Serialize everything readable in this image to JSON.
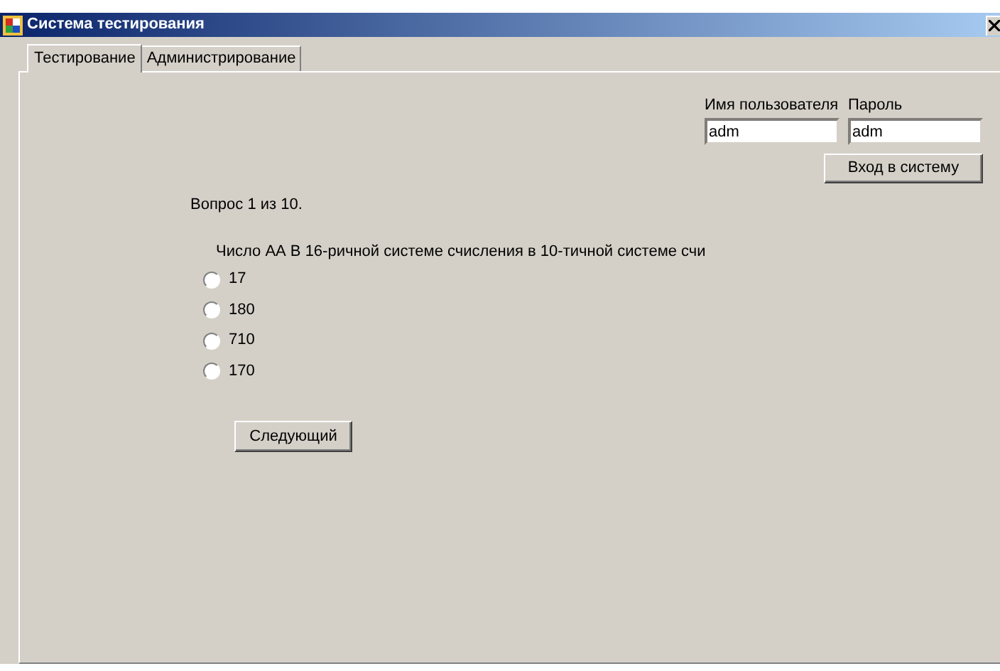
{
  "window": {
    "title": "Система тестирования"
  },
  "tabs": [
    {
      "label": "Тестирование",
      "selected": true
    },
    {
      "label": "Администрирование",
      "selected": false
    }
  ],
  "login": {
    "username_label": "Имя пользователя",
    "username_value": "adm",
    "password_label": "Пароль",
    "password_value": "adm",
    "button": "Вход в систему"
  },
  "question": {
    "counter": "Вопрос 1 из 10.",
    "text": "Число АА В 16-ричной системе счисления в 10-тичной системе счи",
    "options": [
      {
        "label": "17",
        "selected": false
      },
      {
        "label": "180",
        "selected": false
      },
      {
        "label": "710",
        "selected": false
      },
      {
        "label": "170",
        "selected": false
      }
    ]
  },
  "next_button": "Следующий"
}
